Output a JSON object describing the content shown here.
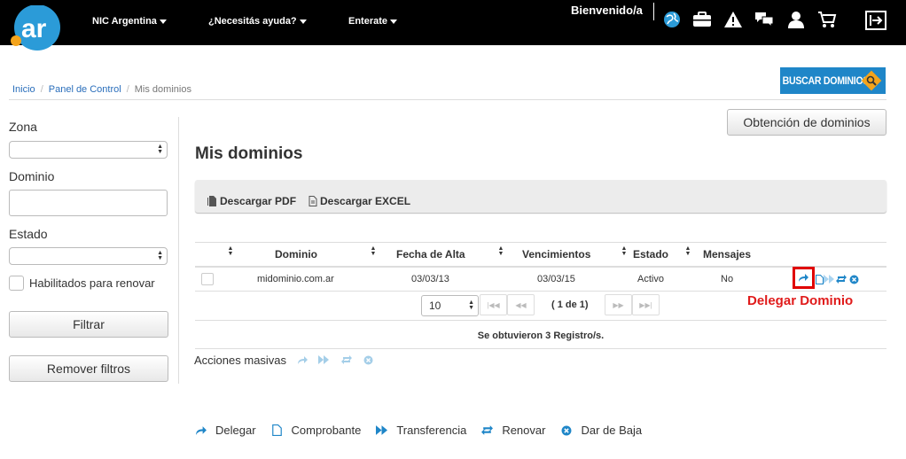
{
  "header": {
    "logo_text": ".ar",
    "nav": [
      {
        "label": "NIC Argentina"
      },
      {
        "label": "¿Necesitás ayuda?"
      },
      {
        "label": "Enterate"
      }
    ],
    "welcome": "Bienvenido/a",
    "icons": [
      "globe-icon",
      "briefcase-icon",
      "warning-icon",
      "chat-icon",
      "user-icon",
      "cart-icon",
      "logout-icon"
    ]
  },
  "breadcrumb": {
    "items": [
      "Inicio",
      "Panel de Control",
      "Mis dominios"
    ],
    "separator": "/"
  },
  "buscar": {
    "label": "BUSCAR DOMINIOS"
  },
  "sidebar": {
    "zona_label": "Zona",
    "zona_value": "",
    "dominio_label": "Dominio",
    "dominio_value": "",
    "estado_label": "Estado",
    "estado_value": "",
    "habilitados_label": "Habilitados para renovar",
    "filtrar_label": "Filtrar",
    "remover_label": "Remover filtros"
  },
  "main": {
    "obtencion_label": "Obtención de dominios",
    "title": "Mis dominios",
    "toolbar": {
      "pdf_label": "Descargar PDF",
      "excel_label": "Descargar EXCEL"
    },
    "columns": [
      "Dominio",
      "Fecha de Alta",
      "Vencimientos",
      "Estado",
      "Mensajes"
    ],
    "rows": [
      {
        "dominio": "midominio.com.ar",
        "fecha_alta": "03/03/13",
        "vencimiento": "03/03/15",
        "estado": "Activo",
        "mensajes": "No"
      }
    ],
    "annotation": "Delegar Dominio",
    "pagination": {
      "page_size": "10",
      "first": "|◀◀",
      "prev": "◀◀",
      "info": "( 1 de 1)",
      "next": "▶▶",
      "last": "▶▶|"
    },
    "count_text": "Se obtuvieron 3 Registro/s.",
    "acciones_label": "Acciones masivas"
  },
  "legend": [
    {
      "icon": "share-arrow-icon",
      "label": "Delegar"
    },
    {
      "icon": "document-icon",
      "label": "Comprobante"
    },
    {
      "icon": "fast-forward-icon",
      "label": "Transferencia"
    },
    {
      "icon": "renew-icon",
      "label": "Renovar"
    },
    {
      "icon": "remove-circle-icon",
      "label": "Dar de Baja"
    }
  ],
  "colors": {
    "accent": "#1f86c8",
    "highlight": "#e01b1b",
    "topbar": "#000000"
  }
}
